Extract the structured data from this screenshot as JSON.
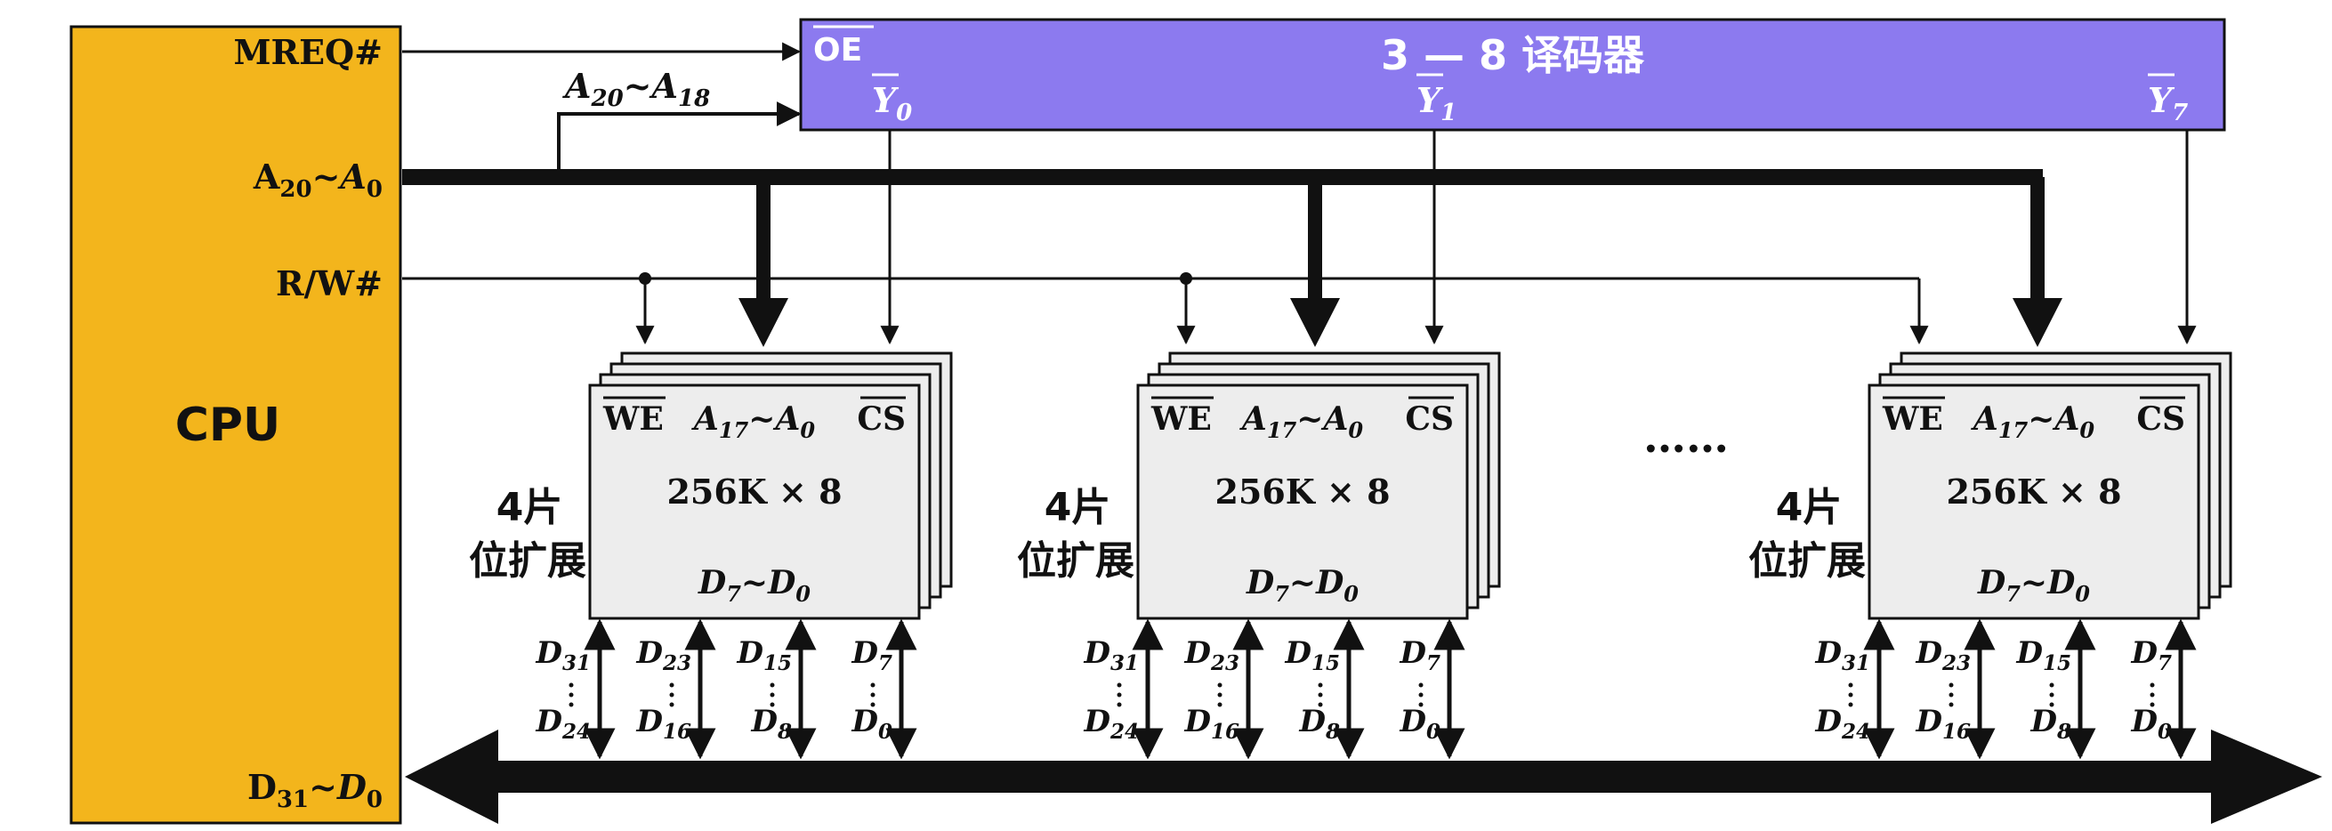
{
  "cpu": {
    "label": "CPU",
    "pins": {
      "mreq": "MREQ#",
      "addr": {
        "base": "A",
        "sub": "20",
        "tilde": "~",
        "base2": "A",
        "sub2": "0"
      },
      "rw": "R/W#",
      "data": {
        "base": "D",
        "sub": "31",
        "tilde": "~",
        "base2": "D",
        "sub2": "0"
      }
    }
  },
  "decoder": {
    "title": "3 — 8 译码器",
    "oe": "OE",
    "outputs": [
      {
        "base": "Y",
        "sub": "0"
      },
      {
        "base": "Y",
        "sub": "1"
      },
      {
        "base": "Y",
        "sub": "7"
      }
    ]
  },
  "addr_to_decoder": {
    "base": "A",
    "sub": "20",
    "tilde": "~",
    "base2": "A",
    "sub2": "18"
  },
  "ellipsis": "……",
  "groups": [
    {
      "side_label_1": "4片",
      "side_label_2": "位扩展",
      "chip": {
        "we": "WE",
        "cs": "CS",
        "addr": {
          "base": "A",
          "sub": "17",
          "tilde": "~",
          "base2": "A",
          "sub2": "0"
        },
        "size": "256K × 8",
        "data": {
          "base": "D",
          "sub": "7",
          "tilde": "~",
          "base2": "D",
          "sub2": "0"
        }
      },
      "data_lines": [
        {
          "top": "31",
          "bottom": "24"
        },
        {
          "top": "23",
          "bottom": "16"
        },
        {
          "top": "15",
          "bottom": "8"
        },
        {
          "top": "7",
          "bottom": "0"
        }
      ]
    },
    {
      "side_label_1": "4片",
      "side_label_2": "位扩展",
      "chip": {
        "we": "WE",
        "cs": "CS",
        "addr": {
          "base": "A",
          "sub": "17",
          "tilde": "~",
          "base2": "A",
          "sub2": "0"
        },
        "size": "256K × 8",
        "data": {
          "base": "D",
          "sub": "7",
          "tilde": "~",
          "base2": "D",
          "sub2": "0"
        }
      },
      "data_lines": [
        {
          "top": "31",
          "bottom": "24"
        },
        {
          "top": "23",
          "bottom": "16"
        },
        {
          "top": "15",
          "bottom": "8"
        },
        {
          "top": "7",
          "bottom": "0"
        }
      ]
    },
    {
      "side_label_1": "4片",
      "side_label_2": "位扩展",
      "chip": {
        "we": "WE",
        "cs": "CS",
        "addr": {
          "base": "A",
          "sub": "17",
          "tilde": "~",
          "base2": "A",
          "sub2": "0"
        },
        "size": "256K × 8",
        "data": {
          "base": "D",
          "sub": "7",
          "tilde": "~",
          "base2": "D",
          "sub2": "0"
        }
      },
      "data_lines": [
        {
          "top": "31",
          "bottom": "24"
        },
        {
          "top": "23",
          "bottom": "16"
        },
        {
          "top": "15",
          "bottom": "8"
        },
        {
          "top": "7",
          "bottom": "0"
        }
      ]
    }
  ],
  "colors": {
    "cpu_fill": "#F3B51C",
    "decoder_fill": "#8C7AEF",
    "chip_fill": "#EDEDED",
    "line": "#111111"
  }
}
